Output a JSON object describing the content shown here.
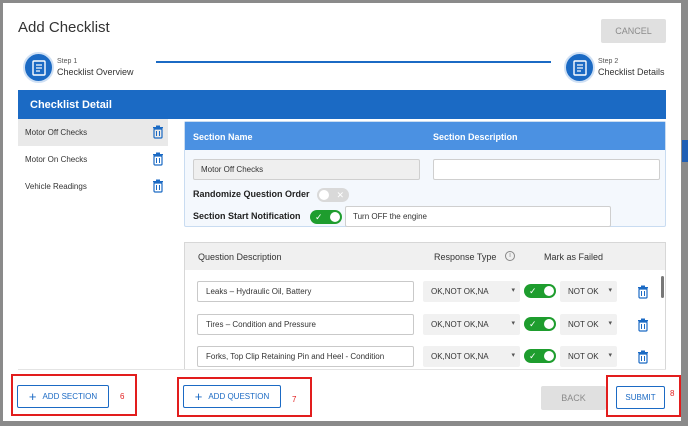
{
  "modal": {
    "title": "Add Checklist",
    "cancel_label": "CANCEL"
  },
  "stepper": {
    "step1": {
      "number": "Step 1",
      "label": "Checklist Overview"
    },
    "step2": {
      "number": "Step 2",
      "label": "Checklist Details"
    }
  },
  "detail_header": "Checklist Detail",
  "sidebar": {
    "items": [
      {
        "label": "Motor Off Checks",
        "active": true
      },
      {
        "label": "Motor On Checks",
        "active": false
      },
      {
        "label": "Vehicle Readings",
        "active": false
      }
    ]
  },
  "section": {
    "name_header": "Section Name",
    "description_header": "Section Description",
    "name_value": "Motor Off Checks",
    "description_value": "",
    "randomize_label": "Randomize Question Order",
    "randomize_on": false,
    "start_notification_label": "Section Start Notification",
    "start_notification_on": true,
    "notification_text": "Turn OFF the engine"
  },
  "questions": {
    "headers": {
      "description": "Question Description",
      "response_type": "Response Type",
      "mark_failed": "Mark as Failed"
    },
    "rows": [
      {
        "description": "Leaks – Hydraulic Oil, Battery",
        "response_type": "OK,NOT OK,NA",
        "failed_toggle_on": true,
        "failed_value": "NOT OK"
      },
      {
        "description": "Tires – Condition and Pressure",
        "response_type": "OK,NOT OK,NA",
        "failed_toggle_on": true,
        "failed_value": "NOT OK"
      },
      {
        "description": "Forks, Top Clip Retaining Pin and Heel - Condition",
        "response_type": "OK,NOT OK,NA",
        "failed_toggle_on": true,
        "failed_value": "NOT OK"
      }
    ]
  },
  "footer": {
    "add_section_label": "ADD SECTION",
    "add_question_label": "ADD QUESTION",
    "back_label": "BACK",
    "submit_label": "SUBMIT",
    "annotation_6": "6",
    "annotation_7": "7",
    "annotation_8": "8"
  },
  "colors": {
    "primary": "#1b6ac4",
    "section_header": "#4b91e2",
    "toggle_on": "#1e9d2e",
    "annotation": "#e21d1d"
  }
}
